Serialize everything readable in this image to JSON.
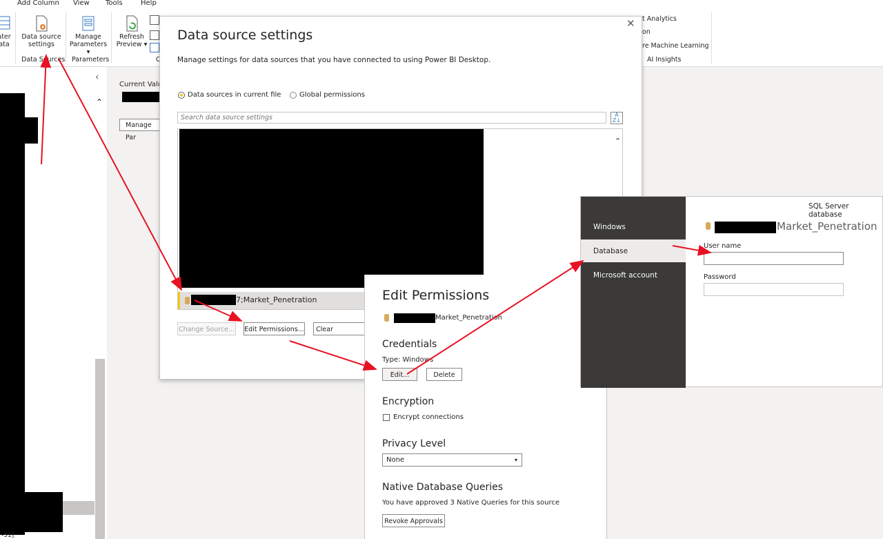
{
  "menu": {
    "items": [
      "Add Column",
      "View",
      "Tools",
      "Help"
    ]
  },
  "ribbon": {
    "partial_left": [
      "ater",
      "ata"
    ],
    "data_source_settings": [
      "Data source",
      "settings"
    ],
    "manage_parameters": [
      "Manage",
      "Parameters"
    ],
    "refresh_preview": [
      "Refresh",
      "Preview"
    ],
    "group_data_sources": "Data Sources",
    "group_parameters": "Parameters",
    "group_partial_c": "C",
    "text_analytics_partial": "t Analytics",
    "vision_partial": "on",
    "azure_ml_partial": "re Machine Learning",
    "group_ai_insights": "AI Insights"
  },
  "query_pane": {
    "current_value_label": "Current Valu",
    "manage_param_label": "Manage Par"
  },
  "status_partial": "-31]",
  "dss": {
    "title": "Data source settings",
    "subtitle": "Manage settings for data sources that you have connected to using Power BI Desktop.",
    "radio_current": "Data sources in current file",
    "radio_global": "Global permissions",
    "search_placeholder": "Search data source settings",
    "selected_source": "7;Market_Penetration",
    "change_source": "Change Source...",
    "edit_permissions": "Edit Permissions...",
    "clear_permissions": "Clear Permissions"
  },
  "ep": {
    "title": "Edit Permissions",
    "source": "Market_Penetration",
    "credentials_heading": "Credentials",
    "type_label": "Type: Windows",
    "edit_button": "Edit...",
    "delete_button": "Delete",
    "encryption_heading": "Encryption",
    "encrypt_label": "Encrypt connections",
    "privacy_heading": "Privacy Level",
    "privacy_value": "None",
    "native_heading": "Native Database Queries",
    "native_text": "You have approved 3 Native Queries for this source",
    "revoke_button": "Revoke Approvals"
  },
  "sql": {
    "header": "SQL Server database",
    "nav": [
      "Windows",
      "Database",
      "Microsoft account"
    ],
    "selected_nav": "Database",
    "source": "Market_Penetration",
    "username_label": "User name",
    "password_label": "Password"
  },
  "colors": {
    "accent": "#f2c811",
    "arrow": "#e81123",
    "sidebar_dark": "#3b3a39",
    "sidebar_selected": "#edebe9"
  }
}
